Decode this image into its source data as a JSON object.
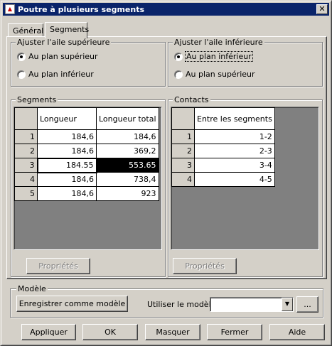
{
  "window": {
    "title": "Poutre à plusieurs segments",
    "close_glyph": "✕"
  },
  "tabs": [
    {
      "label": "Général",
      "active": false
    },
    {
      "label": "Segments",
      "active": true
    }
  ],
  "top_flange": {
    "title": "Ajuster l'aile supérieure",
    "options": [
      {
        "label": "Au plan supérieur",
        "checked": true
      },
      {
        "label": "Au plan inférieur",
        "checked": false
      }
    ]
  },
  "bottom_flange": {
    "title": "Ajuster l'aile inférieure",
    "options": [
      {
        "label": "Au plan inférieur",
        "checked": true
      },
      {
        "label": "Au plan supérieur",
        "checked": false
      }
    ]
  },
  "segments": {
    "title": "Segments",
    "columns": [
      "Longueur",
      "Longueur total"
    ],
    "rows": [
      {
        "n": "1",
        "length": "184,6",
        "total": "184,6"
      },
      {
        "n": "2",
        "length": "184,6",
        "total": "369,2"
      },
      {
        "n": "3",
        "length": "184.55",
        "total": "553.65"
      },
      {
        "n": "4",
        "length": "184,6",
        "total": "738,4"
      },
      {
        "n": "5",
        "length": "184,6",
        "total": "923"
      }
    ],
    "properties_button": "Propriétés"
  },
  "contacts": {
    "title": "Contacts",
    "columns": [
      "Entre les segments"
    ],
    "rows": [
      {
        "n": "1",
        "between": "1-2"
      },
      {
        "n": "2",
        "between": "2-3"
      },
      {
        "n": "3",
        "between": "3-4"
      },
      {
        "n": "4",
        "between": "4-5"
      }
    ],
    "properties_button": "Propriétés"
  },
  "model": {
    "title": "Modèle",
    "save_button": "Enregistrer comme modèle",
    "use_label": "Utiliser le modèle",
    "selected_value": "",
    "browse_button": "..."
  },
  "footer": {
    "apply": "Appliquer",
    "ok": "OK",
    "hide": "Masquer",
    "close": "Fermer",
    "help": "Aide"
  }
}
